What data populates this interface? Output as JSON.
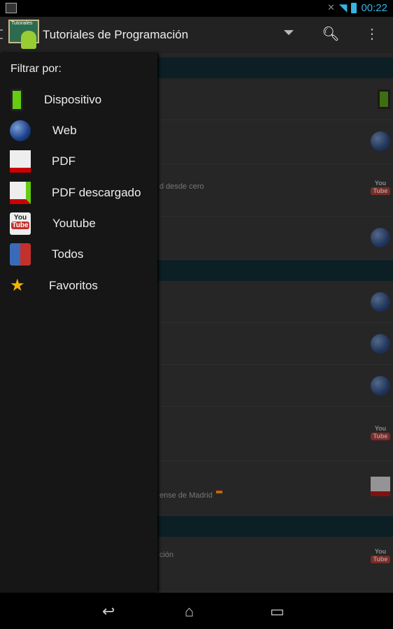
{
  "status_bar": {
    "time": "00:22"
  },
  "action_bar": {
    "title": "Tutoriales de Programación",
    "logo_text": "Tutoriales"
  },
  "drawer": {
    "heading": "Filtrar por:",
    "items": [
      {
        "label": "Dispositivo",
        "icon": "device-icon"
      },
      {
        "label": "Web",
        "icon": "globe-icon"
      },
      {
        "label": "PDF",
        "icon": "pdf-icon"
      },
      {
        "label": "PDF descargado",
        "icon": "pdf-downloaded-icon"
      },
      {
        "label": "Youtube",
        "icon": "youtube-icon"
      },
      {
        "label": "Todos",
        "icon": "all-icon"
      },
      {
        "label": "Favoritos",
        "icon": "star-icon"
      }
    ]
  },
  "list": {
    "rows": [
      {
        "text": "",
        "icon": "device"
      },
      {
        "text": "",
        "icon": "globe"
      },
      {
        "text": "d desde cero",
        "icon": "youtube"
      },
      {
        "text": "",
        "icon": "globe"
      },
      {
        "text": "",
        "icon": "globe"
      },
      {
        "text": "",
        "icon": "globe"
      },
      {
        "text": "",
        "icon": "globe"
      },
      {
        "text": "",
        "icon": "youtube"
      },
      {
        "text": "ense de Madrid",
        "icon": "pdf"
      },
      {
        "text": "ción",
        "icon": "youtube"
      }
    ]
  },
  "colors": {
    "accent": "#33b5e5",
    "section_header": "#0c1f24"
  }
}
